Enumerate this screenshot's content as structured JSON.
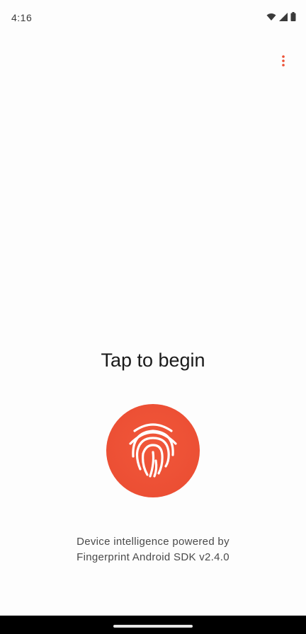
{
  "status_bar": {
    "time": "4:16",
    "icons": [
      "wifi-icon",
      "signal-icon",
      "battery-icon"
    ]
  },
  "toolbar": {
    "menu_icon": "more-vert-icon",
    "accent_color": "#ec4f34"
  },
  "main": {
    "title": "Tap to begin",
    "button_icon": "fingerprint-icon",
    "button_color": "#ec4f34",
    "footer_line1": "Device intelligence powered by",
    "footer_line2": "Fingerprint Android SDK v2.4.0"
  }
}
